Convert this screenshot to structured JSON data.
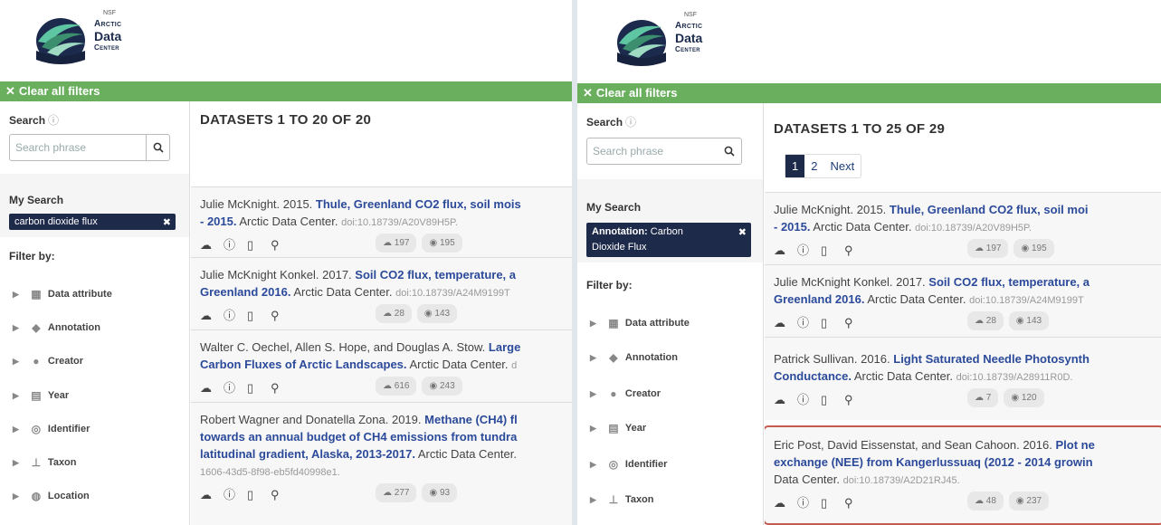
{
  "logo": {
    "nsf": "NSF",
    "line1": "Arctic",
    "line2": "Data",
    "line3": "Center"
  },
  "clear_filters": "Clear all filters",
  "search": {
    "label": "Search",
    "placeholder": "Search phrase"
  },
  "my_search_label": "My Search",
  "filter_by_label": "Filter by:",
  "left": {
    "title": "DATASETS 1 TO 20 OF 20",
    "chip": "carbon dioxide flux",
    "filters": [
      "Data attribute",
      "Annotation",
      "Creator",
      "Year",
      "Identifier",
      "Taxon",
      "Location"
    ],
    "records": [
      {
        "authors": "Julie McKnight. 2015.",
        "title1": "Thule, Greenland CO2 flux, soil mois",
        "title2": "- 2015.",
        "rest": "Arctic Data Center.",
        "doi": "doi:10.18739/A20V89H5P.",
        "downloads": "197",
        "views": "195"
      },
      {
        "authors": "Julie McKnight Konkel. 2017.",
        "title1": "Soil CO2 flux, temperature, a",
        "title2": "Greenland 2016.",
        "rest": "Arctic Data Center.",
        "doi": "doi:10.18739/A24M9199T",
        "downloads": "28",
        "views": "143"
      },
      {
        "authors": "Walter C. Oechel, Allen S. Hope, and Douglas A. Stow.",
        "title1": "Large",
        "title2": "Carbon Fluxes of Arctic Landscapes.",
        "rest": "Arctic Data Center.",
        "doi": "d",
        "downloads": "616",
        "views": "243"
      },
      {
        "authors": "Robert Wagner and Donatella Zona. 2019.",
        "title1": "Methane (CH4) fl",
        "title2": "towards an annual budget of CH4 emissions from tundra",
        "title3": "latitudinal gradient, Alaska, 2013-2017.",
        "rest": "Arctic Data Center.",
        "doi": "1606-43d5-8f98-eb5fd40998e1.",
        "downloads": "277",
        "views": "93"
      }
    ]
  },
  "right": {
    "title": "DATASETS 1 TO 25 OF 29",
    "pager": [
      "1",
      "2",
      "Next"
    ],
    "chip_prefix": "Annotation:",
    "chip_line1": "Carbon",
    "chip_line2": "Dioxide Flux",
    "filters": [
      "Data attribute",
      "Annotation",
      "Creator",
      "Year",
      "Identifier",
      "Taxon"
    ],
    "records": [
      {
        "authors": "Julie McKnight. 2015.",
        "title1": "Thule, Greenland CO2 flux, soil moi",
        "title2": "- 2015.",
        "rest": "Arctic Data Center.",
        "doi": "doi:10.18739/A20V89H5P.",
        "downloads": "197",
        "views": "195"
      },
      {
        "authors": "Julie McKnight Konkel. 2017.",
        "title1": "Soil CO2 flux, temperature, a",
        "title2": "Greenland 2016.",
        "rest": "Arctic Data Center.",
        "doi": "doi:10.18739/A24M9199T",
        "downloads": "28",
        "views": "143"
      },
      {
        "authors": "Patrick Sullivan. 2016.",
        "title1": "Light Saturated Needle Photosynth",
        "title2": "Conductance.",
        "rest": "Arctic Data Center.",
        "doi": "doi:10.18739/A28911R0D.",
        "downloads": "7",
        "views": "120"
      },
      {
        "authors": "Eric Post, David Eissenstat, and Sean Cahoon. 2016.",
        "title1": "Plot ne",
        "title2": "exchange (NEE) from Kangerlussuaq (2012 - 2014 growin",
        "rest2": "Data Center.",
        "doi": "doi:10.18739/A2D21RJ45.",
        "downloads": "48",
        "views": "237"
      }
    ]
  },
  "colors": {
    "green_bar": "#6aaf5e",
    "navy": "#1e2a4a",
    "link": "#2b4a9a",
    "highlight": "#c55a4e"
  }
}
